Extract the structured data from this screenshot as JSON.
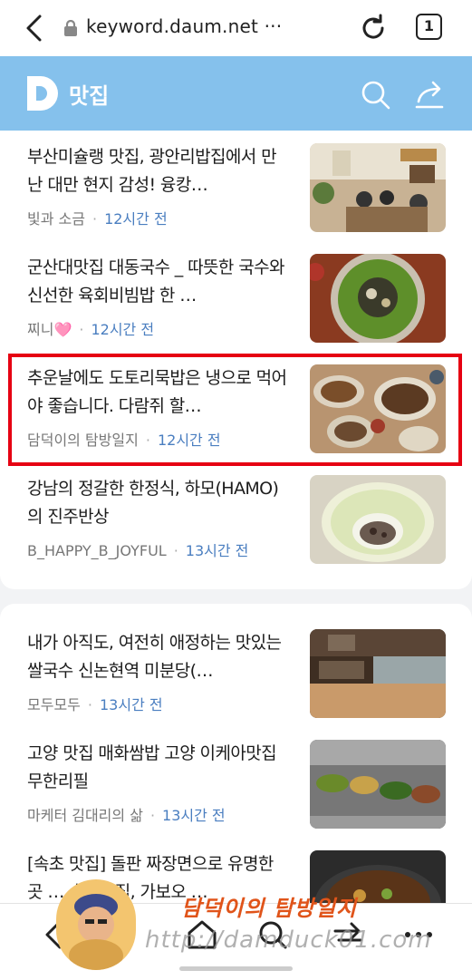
{
  "browser": {
    "url": "keyword.daum.net ···",
    "tab_count": "1"
  },
  "site": {
    "title": "맛집"
  },
  "articles": [
    {
      "title": "부산미슐랭 맛집, 광안리밥집에서 만난 대만 현지 감성! 융캉…",
      "author": "빛과 소금",
      "time": "12시간 전",
      "thumb": "restaurant-interior"
    },
    {
      "title": "군산대맛집 대동국수 _ 따뜻한 국수와 신선한 육회비빔밥 한 …",
      "author": "찌니",
      "author_emoji": "🩷",
      "time": "12시간 전",
      "thumb": "bibimbap-bowl"
    },
    {
      "title": "추운날에도 도토리묵밥은 냉으로 먹어야 좋습니다. 다람쥐 할…",
      "author": "담덕이의 탐방일지",
      "time": "12시간 전",
      "thumb": "korean-table-spread"
    },
    {
      "title": "강남의 정갈한 한정식, 하모(HAMO)의 진주반상",
      "author": "B_HAPPY_B_JOYFUL",
      "time": "13시간 전",
      "thumb": "cabbage-roll"
    },
    {
      "title": "내가 아직도, 여전히 애정하는 맛있는 쌀국수 신논현역 미분당(…",
      "author": "모두모두",
      "time": "13시간 전",
      "thumb": "noodle-shop-kitchen"
    },
    {
      "title": "고양 맛집 매화쌈밥 고양 이케아맛집 무한리필",
      "author": "마케터 김대리의 삶",
      "time": "13시간 전",
      "thumb": "banchan-buffet"
    },
    {
      "title": "[속초 맛집] 돌판 짜장면으로 유명한 곳 … 속초맛집, 가보오 …",
      "author": "",
      "time": "",
      "thumb": "jjajang-pan"
    }
  ],
  "watermark": {
    "title": "담덕이의 탐방일지",
    "url": "http://damduck01.com"
  },
  "colors": {
    "header": "#85c1ec",
    "time": "#4a7ec0",
    "highlight": "#e60012"
  },
  "icons": [
    "back-arrow-icon",
    "lock-icon",
    "reload-icon",
    "search-icon",
    "share-icon",
    "home-icon",
    "forward-icon",
    "more-icon"
  ]
}
